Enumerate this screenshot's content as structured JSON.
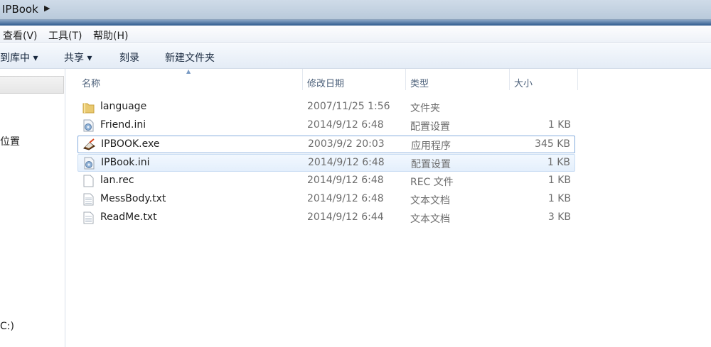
{
  "titlebar": {
    "breadcrumb": "IPBook",
    "arrow": "▶"
  },
  "menu": {
    "view": "查看(V)",
    "tools": "工具(T)",
    "help": "帮助(H)"
  },
  "toolbar": {
    "include": "到库中 ▾",
    "share": "共享 ▾",
    "burn": "刻录",
    "new_folder": "新建文件夹"
  },
  "sidebar": {
    "location": "位置",
    "drive": "C:)"
  },
  "columns": {
    "name": "名称",
    "date": "修改日期",
    "type": "类型",
    "size": "大小"
  },
  "files": [
    {
      "name": "language",
      "date": "2007/11/25 1:56",
      "type": "文件夹",
      "size": "",
      "icon": "folder"
    },
    {
      "name": "Friend.ini",
      "date": "2014/9/12 6:48",
      "type": "配置设置",
      "size": "1 KB",
      "icon": "config"
    },
    {
      "name": "IPBOOK.exe",
      "date": "2003/9/2 20:03",
      "type": "应用程序",
      "size": "345 KB",
      "icon": "app"
    },
    {
      "name": "IPBook.ini",
      "date": "2014/9/12 6:48",
      "type": "配置设置",
      "size": "1 KB",
      "icon": "config"
    },
    {
      "name": "lan.rec",
      "date": "2014/9/12 6:48",
      "type": "REC 文件",
      "size": "1 KB",
      "icon": "file"
    },
    {
      "name": "MessBody.txt",
      "date": "2014/9/12 6:48",
      "type": "文本文档",
      "size": "1 KB",
      "icon": "text"
    },
    {
      "name": "ReadMe.txt",
      "date": "2014/9/12 6:44",
      "type": "文本文档",
      "size": "3 KB",
      "icon": "text"
    }
  ]
}
